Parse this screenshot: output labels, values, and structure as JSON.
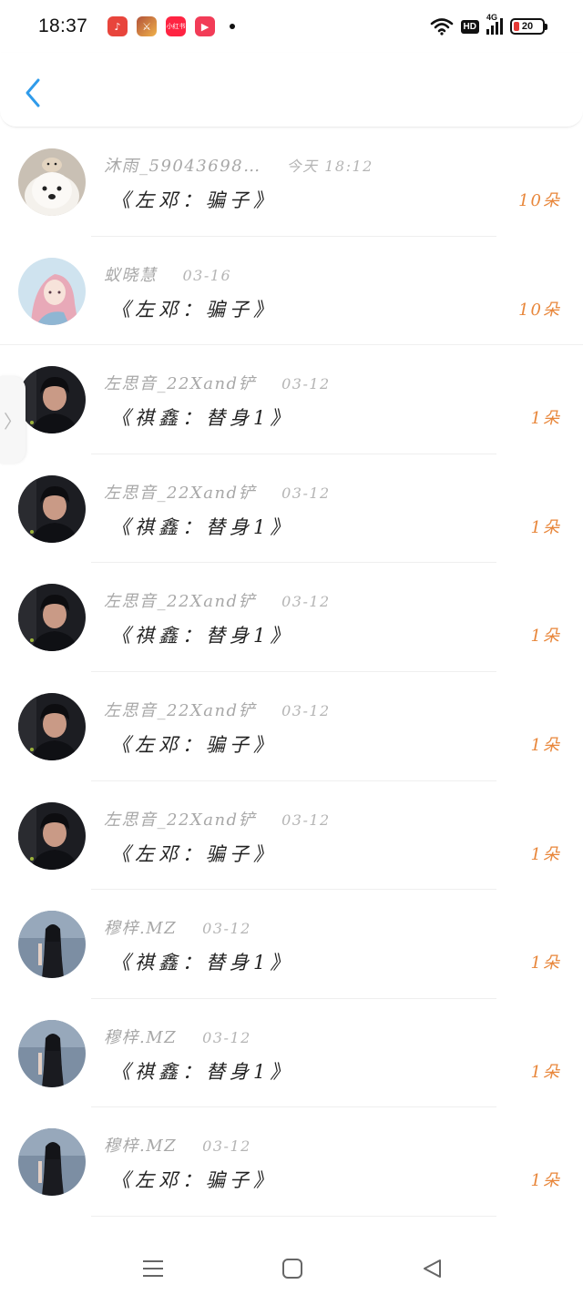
{
  "status_bar": {
    "time": "18:37",
    "app_icons": [
      {
        "name": "music-app-icon",
        "glyph": "♪"
      },
      {
        "name": "game-app-icon",
        "glyph": "⚔"
      },
      {
        "name": "xiaohongshu-app-icon",
        "glyph": "小红书"
      },
      {
        "name": "video-app-icon",
        "glyph": "▶"
      }
    ],
    "hd_label": "HD",
    "network_label": "4G",
    "battery_level": "20",
    "battery_color": "#e53935"
  },
  "header": {
    "back_icon": "chevron-left-icon",
    "accent_color": "#2f9bea"
  },
  "side_tab": {
    "glyph": "〉"
  },
  "rows": [
    {
      "user": "沐雨_59043698…",
      "date": "今天 18:12",
      "gift": "《左邓：骗子》",
      "count": "10朵",
      "avatar": "dog"
    },
    {
      "user": "蚁晓慧",
      "date": "03-16",
      "gift": "《左邓：骗子》",
      "count": "10朵",
      "avatar": "anime"
    },
    {
      "user": "左思音_22Xand铲",
      "date": "03-12",
      "gift": "《祺鑫：替身1》",
      "count": "1朵",
      "avatar": "boy"
    },
    {
      "user": "左思音_22Xand铲",
      "date": "03-12",
      "gift": "《祺鑫：替身1》",
      "count": "1朵",
      "avatar": "boy"
    },
    {
      "user": "左思音_22Xand铲",
      "date": "03-12",
      "gift": "《祺鑫：替身1》",
      "count": "1朵",
      "avatar": "boy"
    },
    {
      "user": "左思音_22Xand铲",
      "date": "03-12",
      "gift": "《左邓：骗子》",
      "count": "1朵",
      "avatar": "boy"
    },
    {
      "user": "左思音_22Xand铲",
      "date": "03-12",
      "gift": "《左邓：骗子》",
      "count": "1朵",
      "avatar": "boy"
    },
    {
      "user": "穆梓.MZ",
      "date": "03-12",
      "gift": "《祺鑫：替身1》",
      "count": "1朵",
      "avatar": "girl"
    },
    {
      "user": "穆梓.MZ",
      "date": "03-12",
      "gift": "《祺鑫：替身1》",
      "count": "1朵",
      "avatar": "girl"
    },
    {
      "user": "穆梓.MZ",
      "date": "03-12",
      "gift": "《左邓：骗子》",
      "count": "1朵",
      "avatar": "girl"
    }
  ],
  "nav_bar": {
    "buttons": [
      "menu-icon",
      "home-icon",
      "back-triangle-icon"
    ]
  }
}
